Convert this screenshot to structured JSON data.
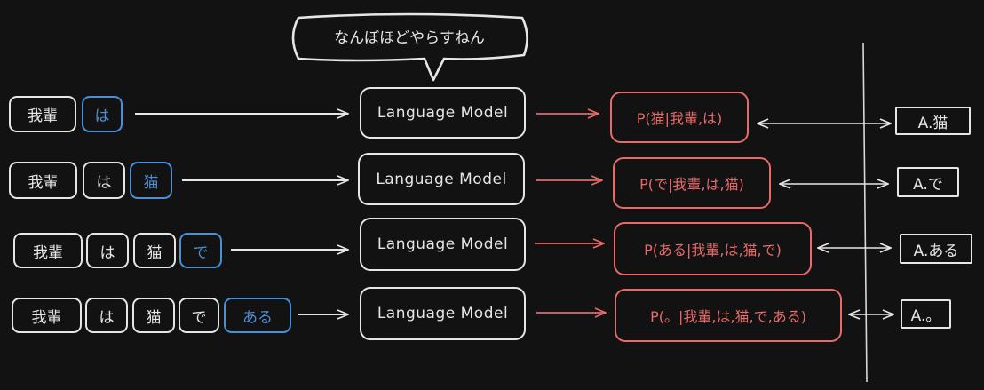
{
  "speech_bubble": "なんぼほどやらすねん",
  "rows": [
    {
      "tokens": [
        {
          "text": "我輩",
          "active": false
        },
        {
          "text": "は",
          "active": true
        }
      ],
      "model": "Language Model",
      "prob": "P(猫|我輩,は)",
      "answer": "A.猫"
    },
    {
      "tokens": [
        {
          "text": "我輩",
          "active": false
        },
        {
          "text": "は",
          "active": false
        },
        {
          "text": "猫",
          "active": true
        }
      ],
      "model": "Language Model",
      "prob": "P(で|我輩,は,猫)",
      "answer": "A.で"
    },
    {
      "tokens": [
        {
          "text": "我輩",
          "active": false
        },
        {
          "text": "は",
          "active": false
        },
        {
          "text": "猫",
          "active": false
        },
        {
          "text": "で",
          "active": true
        }
      ],
      "model": "Language Model",
      "prob": "P(ある|我輩,は,猫,で)",
      "answer": "A.ある"
    },
    {
      "tokens": [
        {
          "text": "我輩",
          "active": false
        },
        {
          "text": "は",
          "active": false
        },
        {
          "text": "猫",
          "active": false
        },
        {
          "text": "で",
          "active": false
        },
        {
          "text": "ある",
          "active": true
        }
      ],
      "model": "Language Model",
      "prob": "P(。|我輩,は,猫,で,ある)",
      "answer": "A.。"
    }
  ],
  "colors": {
    "background": "#121212",
    "stroke": "#e6e6e6",
    "active_token": "#4b8fd6",
    "probability": "#e86a6a"
  }
}
